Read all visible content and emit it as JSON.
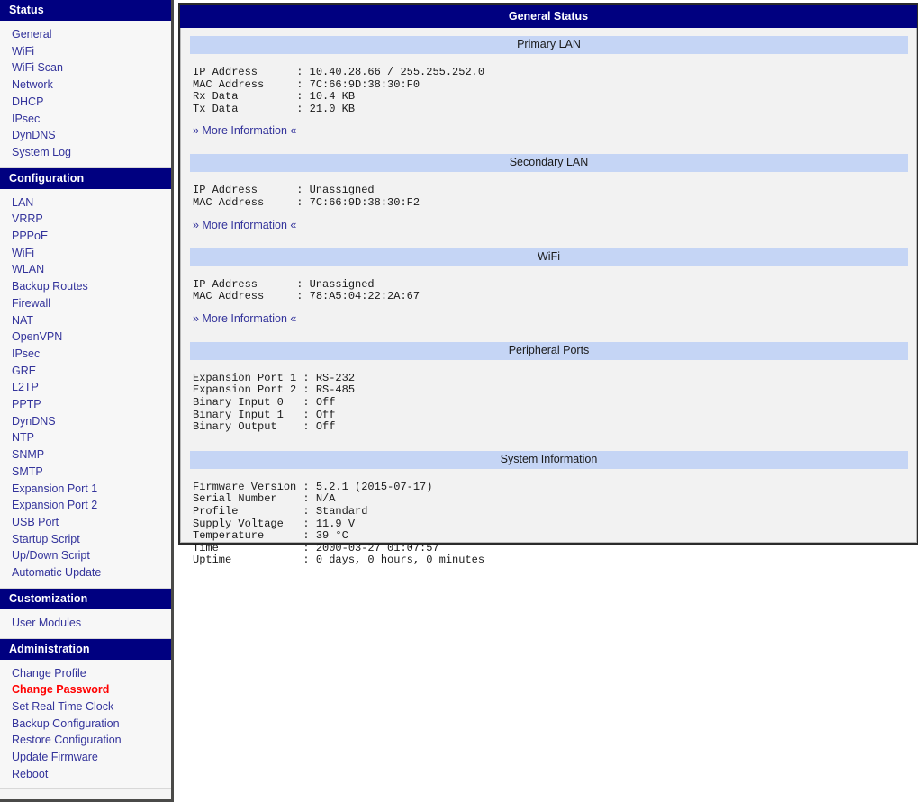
{
  "colors": {
    "header_navy": "#000080",
    "section_bar_blue": "#c5d5f5",
    "link_blue": "#33339b",
    "alert_red": "#ff0000",
    "panel_bg": "#f2f2f2"
  },
  "sidebar": {
    "sections": [
      {
        "title": "Status",
        "items": [
          {
            "label": "General",
            "style": "normal"
          },
          {
            "label": "WiFi",
            "style": "normal"
          },
          {
            "label": "WiFi Scan",
            "style": "normal"
          },
          {
            "label": "Network",
            "style": "normal"
          },
          {
            "label": "DHCP",
            "style": "normal"
          },
          {
            "label": "IPsec",
            "style": "normal"
          },
          {
            "label": "DynDNS",
            "style": "normal"
          },
          {
            "label": "System Log",
            "style": "normal"
          }
        ]
      },
      {
        "title": "Configuration",
        "items": [
          {
            "label": "LAN",
            "style": "normal"
          },
          {
            "label": "VRRP",
            "style": "normal"
          },
          {
            "label": "PPPoE",
            "style": "normal"
          },
          {
            "label": "WiFi",
            "style": "normal"
          },
          {
            "label": "WLAN",
            "style": "normal"
          },
          {
            "label": "Backup Routes",
            "style": "normal"
          },
          {
            "label": "Firewall",
            "style": "normal"
          },
          {
            "label": "NAT",
            "style": "normal"
          },
          {
            "label": "OpenVPN",
            "style": "normal"
          },
          {
            "label": "IPsec",
            "style": "normal"
          },
          {
            "label": "GRE",
            "style": "normal"
          },
          {
            "label": "L2TP",
            "style": "normal"
          },
          {
            "label": "PPTP",
            "style": "normal"
          },
          {
            "label": "DynDNS",
            "style": "normal"
          },
          {
            "label": "NTP",
            "style": "normal"
          },
          {
            "label": "SNMP",
            "style": "normal"
          },
          {
            "label": "SMTP",
            "style": "normal"
          },
          {
            "label": "Expansion Port 1",
            "style": "normal"
          },
          {
            "label": "Expansion Port 2",
            "style": "normal"
          },
          {
            "label": "USB Port",
            "style": "normal"
          },
          {
            "label": "Startup Script",
            "style": "normal"
          },
          {
            "label": "Up/Down Script",
            "style": "normal"
          },
          {
            "label": "Automatic Update",
            "style": "normal"
          }
        ]
      },
      {
        "title": "Customization",
        "items": [
          {
            "label": "User Modules",
            "style": "normal"
          }
        ]
      },
      {
        "title": "Administration",
        "items": [
          {
            "label": "Change Profile",
            "style": "normal"
          },
          {
            "label": "Change Password",
            "style": "alert"
          },
          {
            "label": "Set Real Time Clock",
            "style": "normal"
          },
          {
            "label": "Backup Configuration",
            "style": "normal"
          },
          {
            "label": "Restore Configuration",
            "style": "normal"
          },
          {
            "label": "Update Firmware",
            "style": "normal"
          },
          {
            "label": "Reboot",
            "style": "normal"
          }
        ]
      }
    ]
  },
  "main": {
    "title": "General Status",
    "more_information_label": "» More Information «",
    "sections": [
      {
        "title": "Primary LAN",
        "body": "IP Address      : 10.40.28.66 / 255.255.252.0\nMAC Address     : 7C:66:9D:38:30:F0\nRx Data         : 10.4 KB\nTx Data         : 21.0 KB",
        "fields": [
          {
            "label": "IP Address",
            "value": "10.40.28.66 / 255.255.252.0"
          },
          {
            "label": "MAC Address",
            "value": "7C:66:9D:38:30:F0"
          },
          {
            "label": "Rx Data",
            "value": "10.4 KB"
          },
          {
            "label": "Tx Data",
            "value": "21.0 KB"
          }
        ],
        "has_more_link": true
      },
      {
        "title": "Secondary LAN",
        "body": "IP Address      : Unassigned\nMAC Address     : 7C:66:9D:38:30:F2",
        "fields": [
          {
            "label": "IP Address",
            "value": "Unassigned"
          },
          {
            "label": "MAC Address",
            "value": "7C:66:9D:38:30:F2"
          }
        ],
        "has_more_link": true
      },
      {
        "title": "WiFi",
        "body": "IP Address      : Unassigned\nMAC Address     : 78:A5:04:22:2A:67",
        "fields": [
          {
            "label": "IP Address",
            "value": "Unassigned"
          },
          {
            "label": "MAC Address",
            "value": "78:A5:04:22:2A:67"
          }
        ],
        "has_more_link": true
      },
      {
        "title": "Peripheral Ports",
        "body": "Expansion Port 1 : RS-232\nExpansion Port 2 : RS-485\nBinary Input 0   : Off\nBinary Input 1   : Off\nBinary Output    : Off",
        "fields": [
          {
            "label": "Expansion Port 1",
            "value": "RS-232"
          },
          {
            "label": "Expansion Port 2",
            "value": "RS-485"
          },
          {
            "label": "Binary Input 0",
            "value": "Off"
          },
          {
            "label": "Binary Input 1",
            "value": "Off"
          },
          {
            "label": "Binary Output",
            "value": "Off"
          }
        ],
        "has_more_link": false
      },
      {
        "title": "System Information",
        "body": "Firmware Version : 5.2.1 (2015-07-17)\nSerial Number    : N/A\nProfile          : Standard\nSupply Voltage   : 11.9 V\nTemperature      : 39 °C\nTime             : 2000-03-27 01:07:57\nUptime           : 0 days, 0 hours, 0 minutes",
        "fields": [
          {
            "label": "Firmware Version",
            "value": "5.2.1 (2015-07-17)"
          },
          {
            "label": "Serial Number",
            "value": "N/A"
          },
          {
            "label": "Profile",
            "value": "Standard"
          },
          {
            "label": "Supply Voltage",
            "value": "11.9 V"
          },
          {
            "label": "Temperature",
            "value": "39 °C"
          },
          {
            "label": "Time",
            "value": "2000-03-27 01:07:57"
          },
          {
            "label": "Uptime",
            "value": "0 days, 0 hours, 0 minutes"
          }
        ],
        "has_more_link": false
      }
    ]
  }
}
